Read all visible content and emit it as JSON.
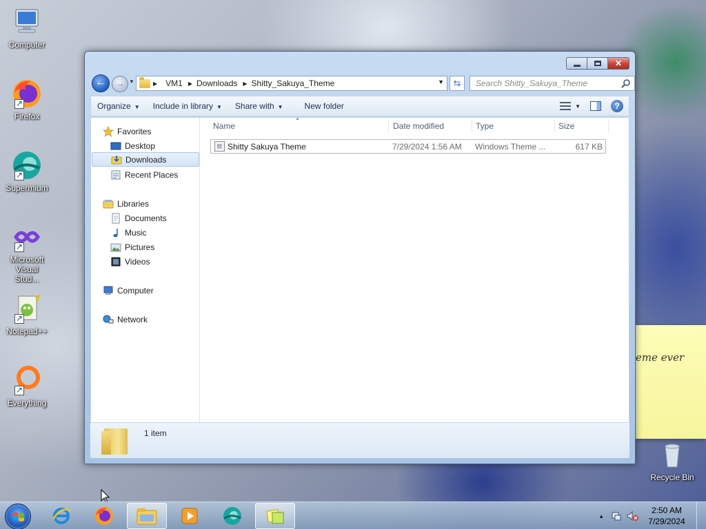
{
  "desktop": {
    "icons": [
      {
        "label": "Computer"
      },
      {
        "label": "Firefox"
      },
      {
        "label": "Supermium"
      },
      {
        "label": "Microsoft Visual Stud..."
      },
      {
        "label": "Notepad++"
      },
      {
        "label": "Everything"
      },
      {
        "label": "Recycle Bin"
      }
    ],
    "sticky_note_text": "eme ever"
  },
  "window": {
    "breadcrumb": [
      "VM1",
      "Downloads",
      "Shitty_Sakuya_Theme"
    ],
    "search_placeholder": "Search Shitty_Sakuya_Theme",
    "toolbar": {
      "organize": "Organize",
      "include_in_library": "Include in library",
      "share_with": "Share with",
      "new_folder": "New folder"
    },
    "nav": {
      "favorites": "Favorites",
      "desktop": "Desktop",
      "downloads": "Downloads",
      "recent_places": "Recent Places",
      "libraries": "Libraries",
      "documents": "Documents",
      "music": "Music",
      "pictures": "Pictures",
      "videos": "Videos",
      "computer": "Computer",
      "network": "Network"
    },
    "columns": {
      "name": "Name",
      "date_modified": "Date modified",
      "type": "Type",
      "size": "Size"
    },
    "files": [
      {
        "name": "Shitty Sakuya Theme",
        "date": "7/29/2024 1:56 AM",
        "type": "Windows Theme ...",
        "size": "617 KB"
      }
    ],
    "status": "1 item"
  },
  "taskbar": {
    "time": "2:50 AM",
    "date": "7/29/2024"
  },
  "colors": {
    "selection": "#d3e4f7",
    "window_frame": "#b4cce9",
    "close_button": "#c8483a"
  }
}
